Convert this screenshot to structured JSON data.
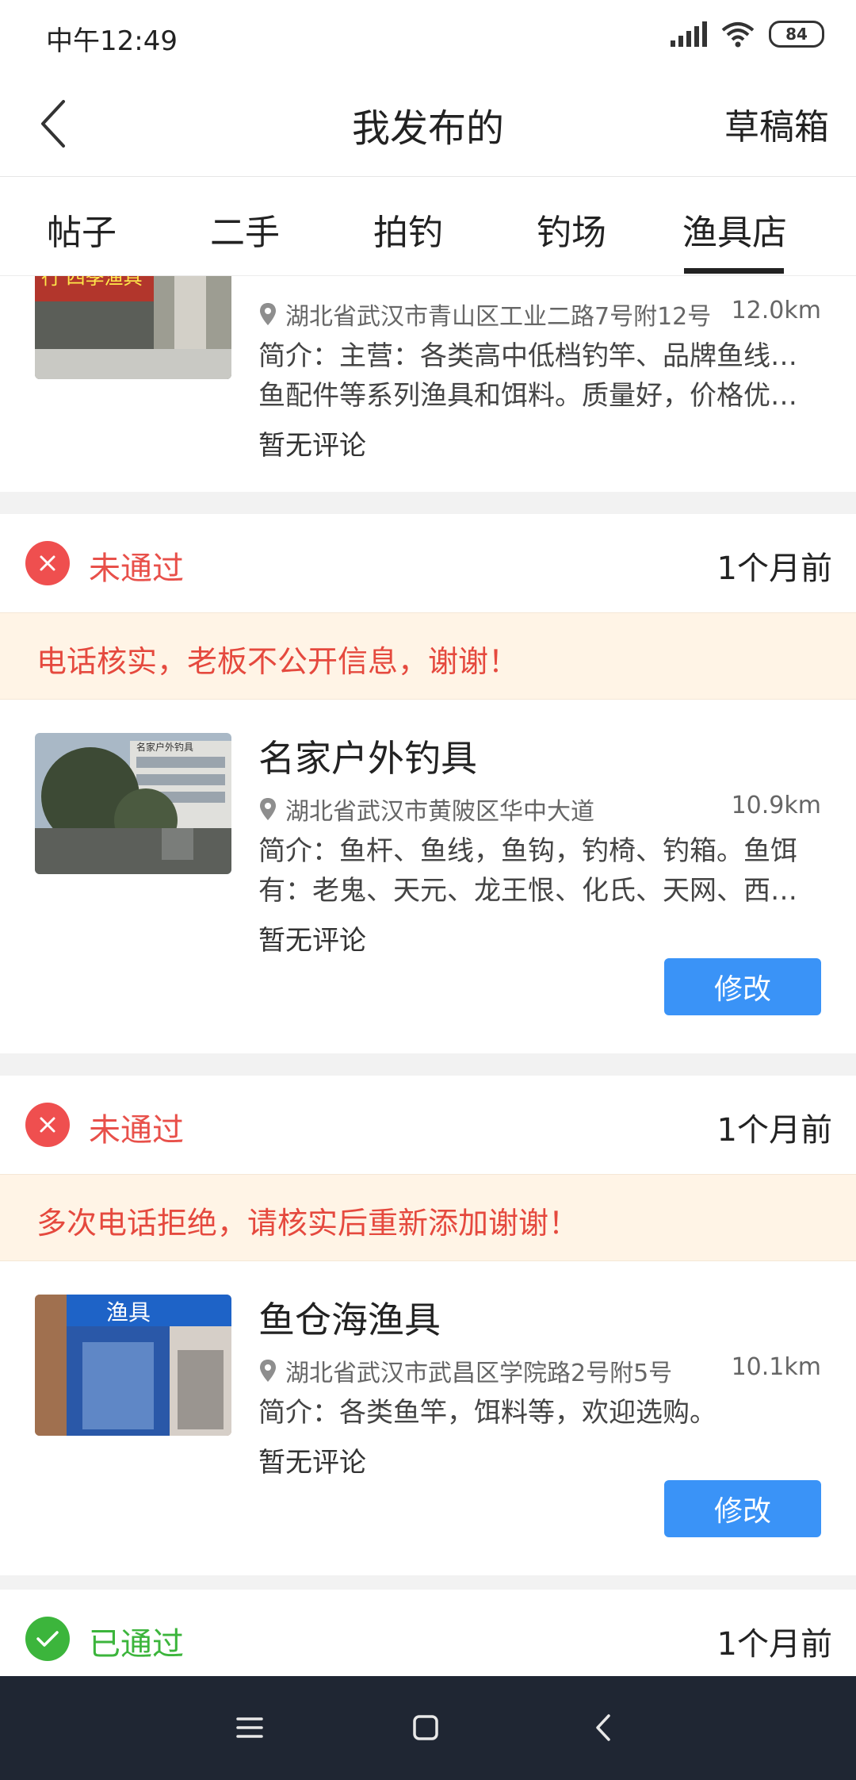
{
  "status_bar": {
    "time": "中午12:49",
    "battery": "84"
  },
  "header": {
    "title": "我发布的",
    "right_action": "草稿箱"
  },
  "tabs": [
    {
      "label": "帖子",
      "active": false
    },
    {
      "label": "二手",
      "active": false
    },
    {
      "label": "拍钓",
      "active": false
    },
    {
      "label": "钓场",
      "active": false
    },
    {
      "label": "渔具店",
      "active": true
    }
  ],
  "shop0": {
    "address": "湖北省武汉市青山区工业二路7号附12号",
    "distance": "12.0km",
    "intro_lines": [
      "简介：主营：各类高中低档钓竿、品牌鱼线、钓",
      "鱼配件等系列渔具和饵料。质量好，价格优，…"
    ],
    "review": "暂无评论",
    "sign_text": "行 四季渔具"
  },
  "post1": {
    "status": "未通过",
    "time_ago": "1个月前",
    "reason": "电话核实，老板不公开信息，谢谢！",
    "shop_name": "名家户外钓具",
    "address": "湖北省武汉市黄陂区华中大道",
    "distance": "10.9km",
    "intro_lines": [
      "简介：鱼杆、鱼线，鱼钩，钓椅、钓箱。鱼饵",
      "有：老鬼、天元、龙王恨、化氏、天网、西部…"
    ],
    "review": "暂无评论",
    "edit_label": "修改",
    "sign_text": "名家户外钓具"
  },
  "post2": {
    "status": "未通过",
    "time_ago": "1个月前",
    "reason": "多次电话拒绝，请核实后重新添加谢谢！",
    "shop_name": "鱼仓海渔具",
    "address": "湖北省武汉市武昌区学院路2号附5号",
    "distance": "10.1km",
    "intro_lines": [
      "简介：各类鱼竿，饵料等，欢迎选购。"
    ],
    "review": "暂无评论",
    "edit_label": "修改",
    "sign_text": "渔具"
  },
  "post3": {
    "status": "已通过",
    "time_ago": "1个月前"
  },
  "colors": {
    "fail": "#e8504a",
    "pass": "#3cb53c",
    "button": "#3a93f7",
    "reason_bg": "#fff4e6",
    "nav_bar": "#1f2633"
  }
}
